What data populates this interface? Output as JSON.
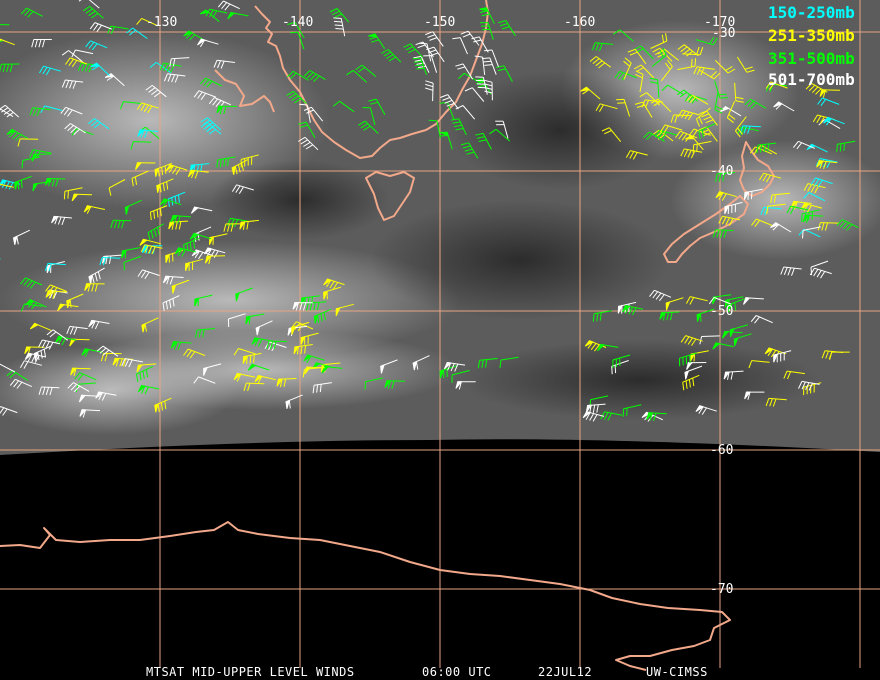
{
  "colors": {
    "grid": "#e8a584",
    "coast": "#f2a88a",
    "background": "#000000",
    "level_150_250": "#00ffff",
    "level_251_350": "#ffff00",
    "level_351_500": "#00ff00",
    "level_501_700": "#ffffff"
  },
  "longitude_labels": [
    "-130",
    "-140",
    "-150",
    "-160",
    "-170"
  ],
  "latitude_labels": [
    "-30",
    "-40",
    "-50",
    "-60",
    "-70"
  ],
  "legend": [
    {
      "label": "150-250mb",
      "color": "#00ffff"
    },
    {
      "label": "251-350mb",
      "color": "#ffff00"
    },
    {
      "label": "351-500mb",
      "color": "#00ff00"
    },
    {
      "label": "501-700mb",
      "color": "#ffffff"
    }
  ],
  "footer": {
    "product": "MTSAT MID-UPPER LEVEL WINDS",
    "time": "06:00 UTC",
    "date": "22JUL12",
    "source": "UW-CIMSS"
  }
}
